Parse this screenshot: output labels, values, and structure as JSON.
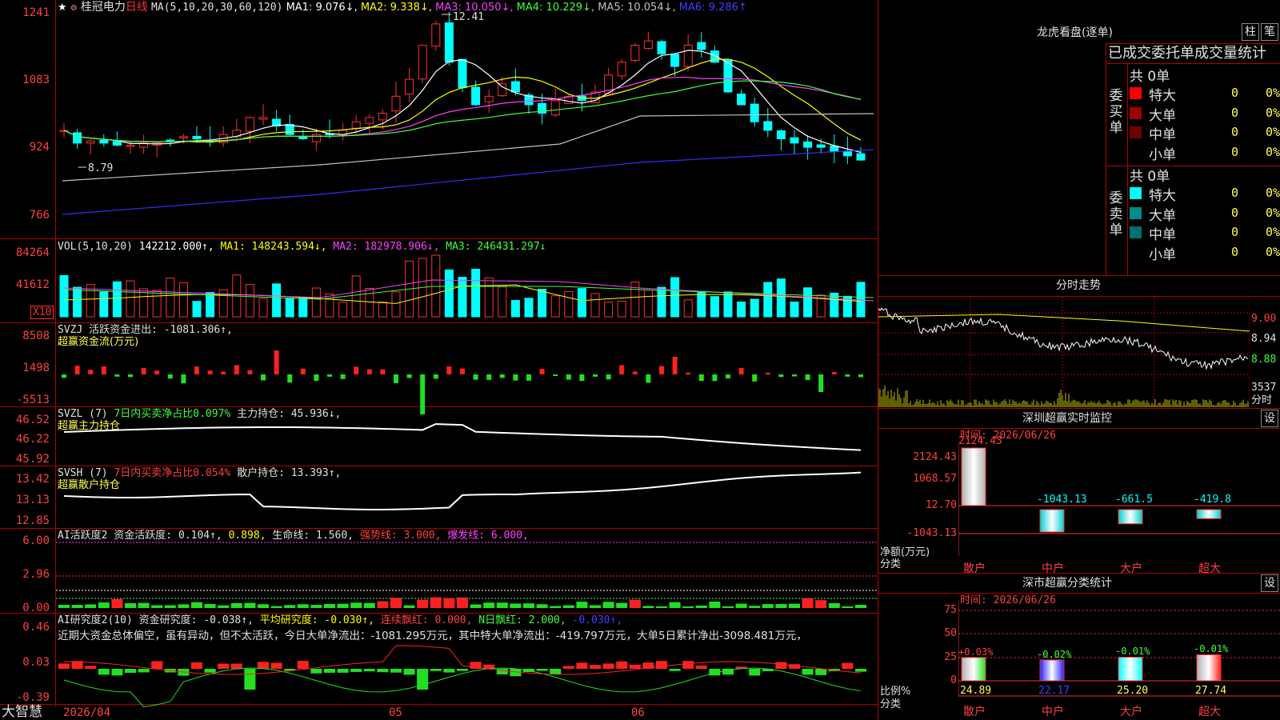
{
  "chart": {
    "stock_name": "桂冠电力",
    "period": "日线",
    "ma_label": "MA(5,10,20,30,60,120)",
    "ma_values": [
      {
        "label": "MA1: 9.076↓,",
        "color": "#ffffff"
      },
      {
        "label": "MA2: 9.338↓,",
        "color": "#ffff00"
      },
      {
        "label": "MA3: 10.050↓,",
        "color": "#ff40ff"
      },
      {
        "label": "MA4: 10.229↓,",
        "color": "#40ff40"
      },
      {
        "label": "MA5: 10.054↓,",
        "color": "#c0c0c0"
      },
      {
        "label": "MA6: 9.286↑",
        "color": "#4040ff"
      }
    ],
    "price_axis": [
      "1241",
      "1083",
      "924",
      "766"
    ],
    "high_marker": "12.41",
    "low_marker": "8.79",
    "vol_label": "VOL(5,10,20)",
    "vol_values": [
      {
        "label": "142212.000↑,",
        "color": "#ffffff"
      },
      {
        "label": "MA1: 148243.594↓,",
        "color": "#ffff00"
      },
      {
        "label": "MA2: 182978.906↓,",
        "color": "#ff40ff"
      },
      {
        "label": "MA3: 246431.297↓",
        "color": "#40ff40"
      }
    ],
    "vol_axis": [
      "84264",
      "41612"
    ],
    "vol_unit": "X10",
    "svzj_title": "SVZJ  活跃资金进出: -1081.306↑,",
    "svzj_sub": "超赢资金流(万元)",
    "svzj_axis": [
      "8508",
      "1498",
      "-5513"
    ],
    "svzl_title_a": "SVZL (7)",
    "svzl_title_b": "7日内买卖净占比0.097%",
    "svzl_title_c": "主力持仓: 45.936↓,",
    "svzl_sub": "超赢主力持仓",
    "svzl_axis": [
      "46.52",
      "46.22",
      "45.92"
    ],
    "svsh_title_a": "SVSH (7)",
    "svsh_title_b": "7日内买卖净占比0.054%",
    "svsh_title_c": "散户持仓: 13.393↑,",
    "svsh_sub": "超赢散户持仓",
    "svsh_axis": [
      "13.42",
      "13.13",
      "12.85"
    ],
    "ai1_title": [
      {
        "label": "AI活跃度2 资金活跃度: 0.104↑,",
        "color": "#e0e0e0"
      },
      {
        "label": "0.898,",
        "color": "#ffff00"
      },
      {
        "label": "生命线: 1.560,",
        "color": "#e0e0e0"
      },
      {
        "label": "强势线: 3.000,",
        "color": "#ff4040"
      },
      {
        "label": "爆发线: 6.000,",
        "color": "#ff40ff"
      }
    ],
    "ai1_axis": [
      "6.00",
      "2.96",
      "0.00"
    ],
    "ai2_title": [
      {
        "label": "AI研究度2(10) 资金研究度: -0.038↑,",
        "color": "#e0e0e0"
      },
      {
        "label": "平均研究度: -0.030↑,",
        "color": "#ffff00"
      },
      {
        "label": "连续飘红: 0.000,",
        "color": "#ff4040"
      },
      {
        "label": "N日飘红: 2.000,",
        "color": "#40ff40"
      },
      {
        "label": "-0.030↑,",
        "color": "#4040ff"
      }
    ],
    "ai2_text": "近期大资金总体偏空，虽有异动，但不太活跃，今日大单净流出：-1081.295万元，其中特大单净流出：-419.797万元，大单5日累计净出-3098.481万元，",
    "ai2_axis": [
      "0.46",
      "0.03",
      "-0.39"
    ],
    "date_axis": [
      "2026/04",
      "05",
      "06"
    ],
    "brand": "大智慧"
  },
  "lhb": {
    "title": "龙虎看盘(逐单)",
    "btn_zhu": "柱",
    "btn_bi": "笔",
    "header": "已成交委托单成交量统计",
    "buy_label": "委买单",
    "sell_label": "委卖单",
    "buy_total": "共 0单",
    "sell_total": "共 0单",
    "buy_rows": [
      {
        "name": "特大",
        "count": "0",
        "pct": "0%",
        "color": "#ff0000"
      },
      {
        "name": "大单",
        "count": "0",
        "pct": "0%",
        "color": "#a00000"
      },
      {
        "name": "中单",
        "count": "0",
        "pct": "0%",
        "color": "#700000"
      },
      {
        "name": "小单",
        "count": "0",
        "pct": "0%",
        "color": ""
      }
    ],
    "sell_rows": [
      {
        "name": "特大",
        "count": "0",
        "pct": "0%",
        "color": "#00ffff"
      },
      {
        "name": "大单",
        "count": "0",
        "pct": "0%",
        "color": "#008b8b"
      },
      {
        "name": "中单",
        "count": "0",
        "pct": "0%",
        "color": "#007070"
      },
      {
        "name": "小单",
        "count": "0",
        "pct": "0%",
        "color": ""
      }
    ]
  },
  "intraday": {
    "title": "分时走势",
    "axis": [
      "9.00",
      "8.94",
      "8.88"
    ],
    "vol": "3537",
    "unit": "分时"
  },
  "sz_monitor": {
    "title": "深圳超赢实时监控",
    "btn": "设",
    "time": "时间: 2026/06/26",
    "axis": [
      "2124.43",
      "1068.57",
      "12.70",
      "-1043.13"
    ],
    "axis_unit_a": "净额(万元)",
    "axis_unit_b": "分类",
    "bars": [
      {
        "label": "散户",
        "value": "2124.43"
      },
      {
        "label": "中户",
        "value": "-1043.13"
      },
      {
        "label": "大户",
        "value": "-661.5"
      },
      {
        "label": "超大",
        "value": "-419.8"
      }
    ]
  },
  "sz_class": {
    "title": "深市超赢分类统计",
    "btn": "设",
    "time": "时间: 2026/06/26",
    "axis": [
      "75",
      "50",
      "25",
      "0"
    ],
    "axis_unit_a": "比例%",
    "axis_unit_b": "分类",
    "bars": [
      {
        "label": "散户",
        "change": "+0.03%",
        "value": "24.89"
      },
      {
        "label": "中户",
        "change": "-0.02%",
        "value": "22.17"
      },
      {
        "label": "大户",
        "change": "-0.01%",
        "value": "25.20"
      },
      {
        "label": "超大",
        "change": "-0.01%",
        "value": "27.74"
      }
    ]
  }
}
